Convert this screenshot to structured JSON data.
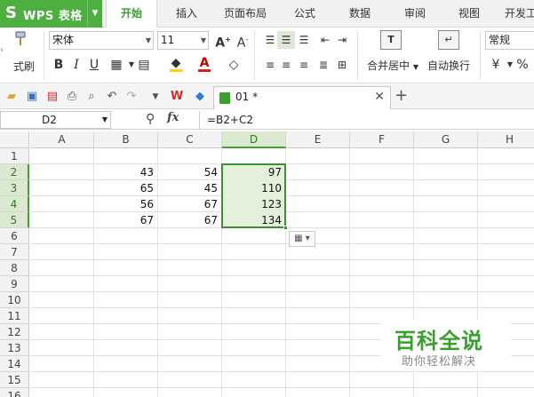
{
  "app": {
    "logo": "S",
    "title": "WPS 表格"
  },
  "menu": {
    "tabs": [
      "开始",
      "插入",
      "页面布局",
      "公式",
      "数据",
      "审阅",
      "视图",
      "开发工"
    ],
    "active": "开始"
  },
  "ribbon": {
    "format_painter_label": "式刷",
    "font_name": "宋体",
    "font_size": "11",
    "merge_label": "合并居中",
    "wrap_label": "自动换行",
    "number_format": "常规",
    "colors": {
      "fill": "#ffd200",
      "font": "#e02020"
    }
  },
  "quickbar": {
    "doc_name": "01 *"
  },
  "formula_bar": {
    "cell_ref": "D2",
    "fx": "fx",
    "formula": "=B2+C2"
  },
  "sheet": {
    "columns": [
      "A",
      "B",
      "C",
      "D",
      "E",
      "F",
      "G",
      "H"
    ],
    "rows": [
      "1",
      "2",
      "3",
      "4",
      "5",
      "6",
      "7",
      "8",
      "9",
      "10",
      "11",
      "12",
      "13",
      "14",
      "15",
      "16"
    ],
    "selected_column": "D",
    "selected_rows": [
      "2",
      "3",
      "4",
      "5"
    ],
    "data": [
      {
        "row": "2",
        "B": "43",
        "C": "54",
        "D": "97"
      },
      {
        "row": "3",
        "B": "65",
        "C": "45",
        "D": "110"
      },
      {
        "row": "4",
        "B": "56",
        "C": "67",
        "D": "123"
      },
      {
        "row": "5",
        "B": "67",
        "C": "67",
        "D": "134"
      }
    ]
  },
  "watermark": {
    "main": "百科全说",
    "sub": "助你轻松解决"
  }
}
